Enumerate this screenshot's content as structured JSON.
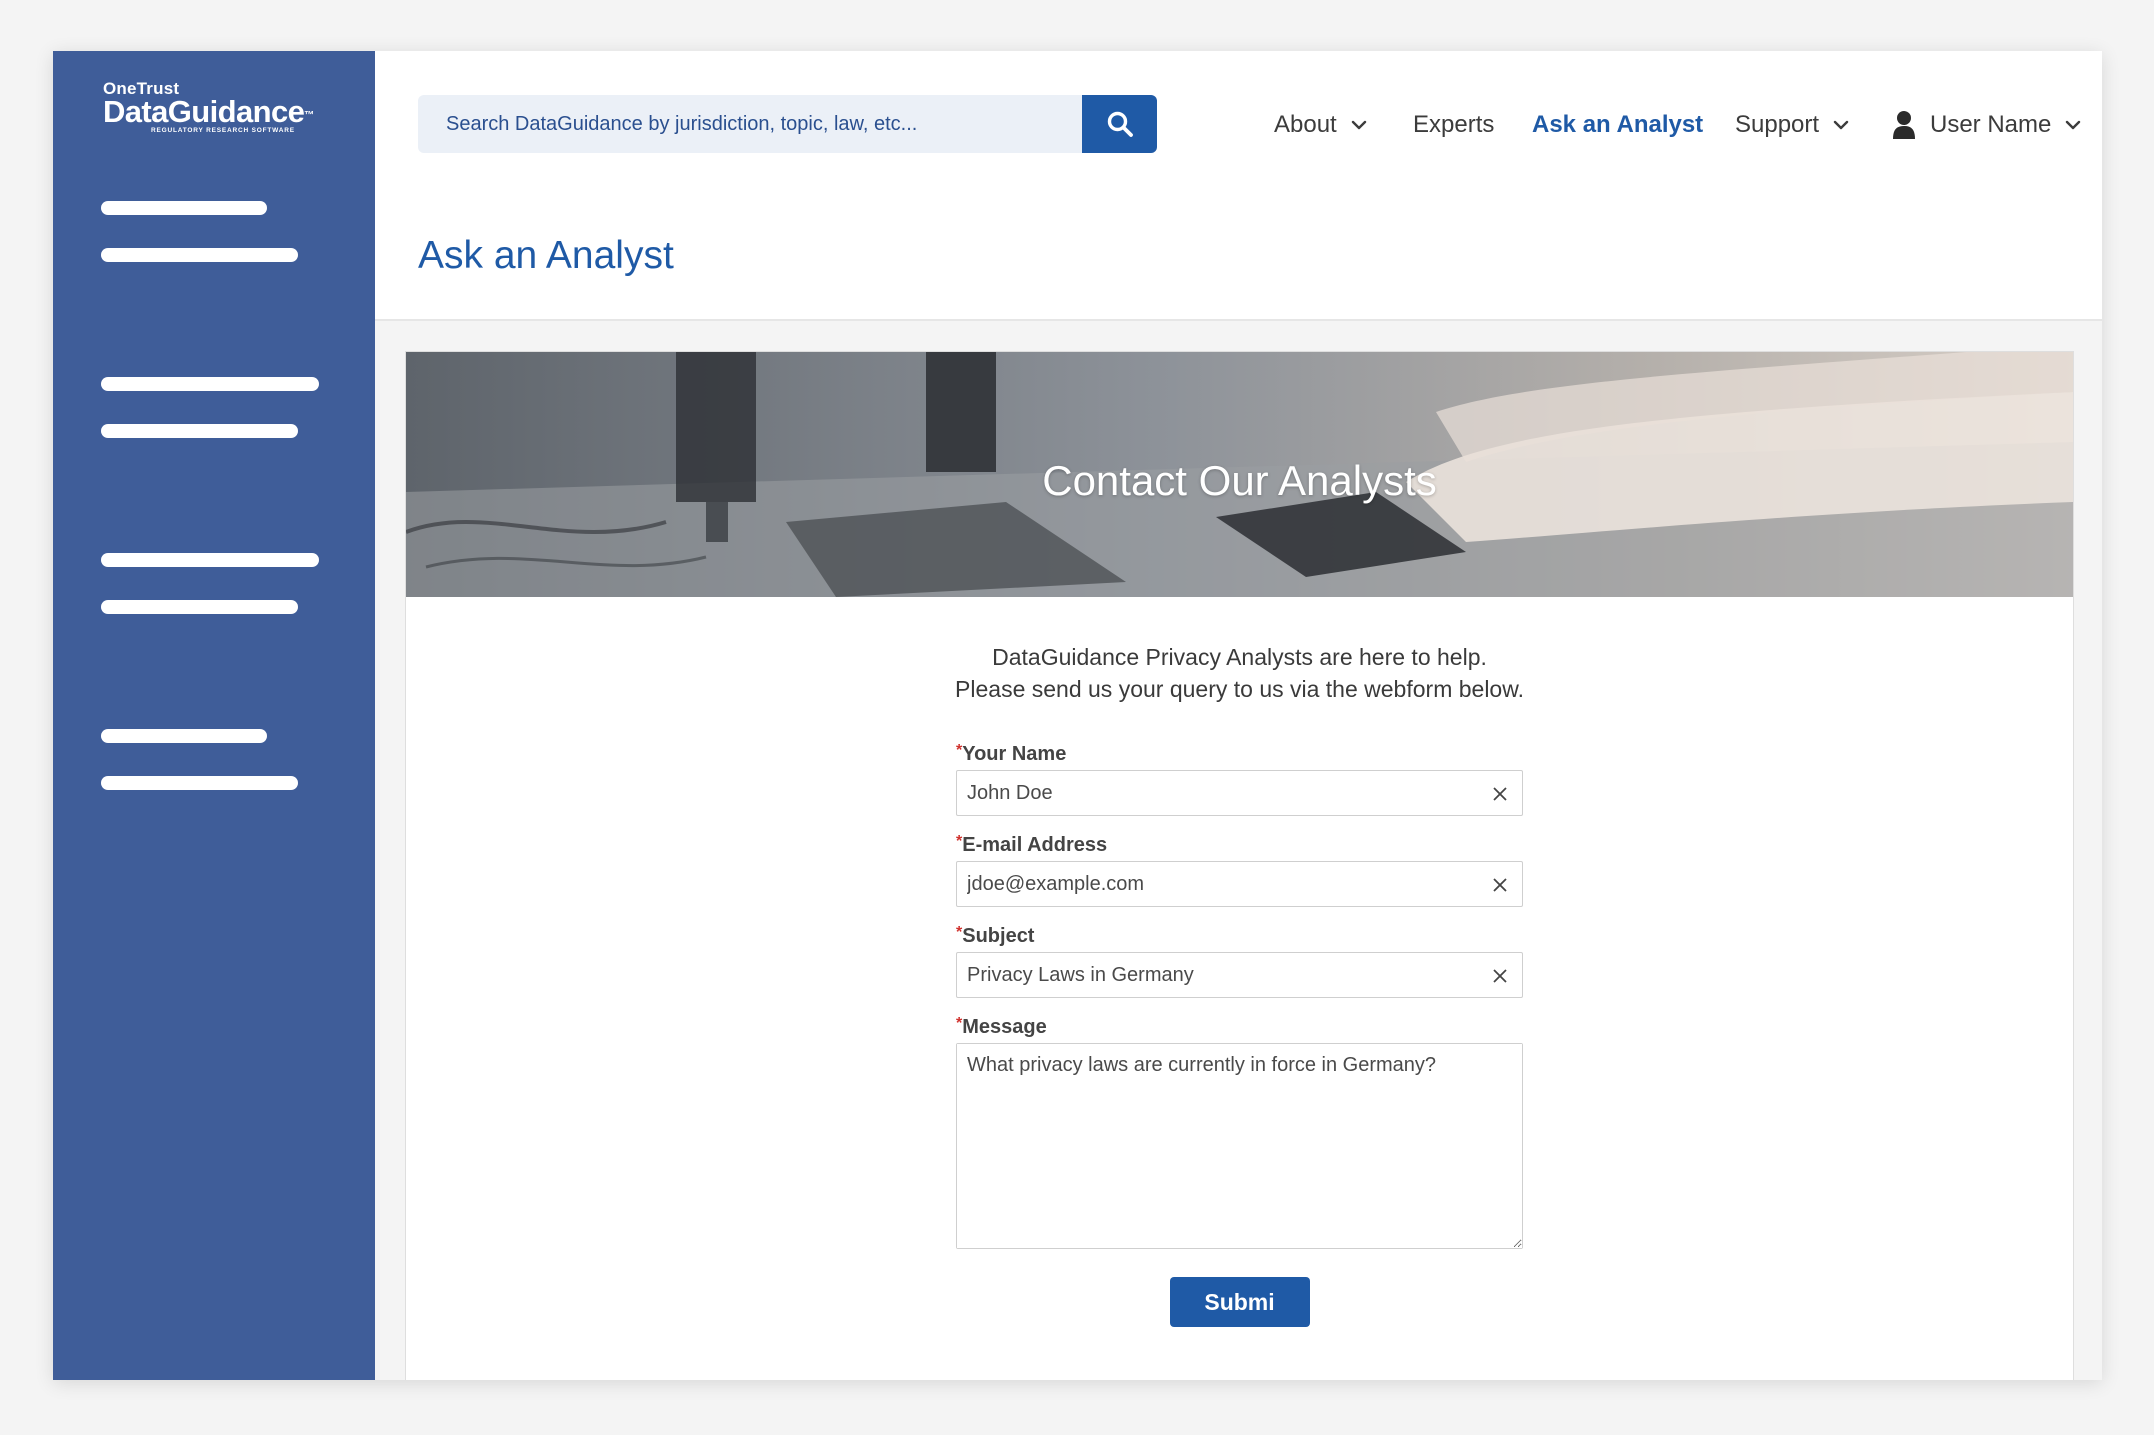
{
  "brand": {
    "company": "OneTrust",
    "product": "DataGuidance",
    "trademark": "™",
    "tagline": "REGULATORY RESEARCH SOFTWARE"
  },
  "search": {
    "placeholder": "Search DataGuidance by jurisdiction, topic, law, etc...",
    "button_icon": "search-icon"
  },
  "nav": {
    "items": [
      {
        "label": "About",
        "has_dropdown": true
      },
      {
        "label": "Experts",
        "has_dropdown": false
      },
      {
        "label": "Ask an Analyst",
        "has_dropdown": false,
        "active": true
      },
      {
        "label": "Support",
        "has_dropdown": true
      }
    ],
    "user": {
      "label": "User Name",
      "icon": "user-icon",
      "has_dropdown": true
    }
  },
  "page": {
    "title": "Ask an Analyst"
  },
  "hero": {
    "title": "Contact Our Analysts"
  },
  "intro": {
    "line1": "DataGuidance Privacy Analysts are here to help.",
    "line2": "Please send us your query to us via the webform below."
  },
  "form": {
    "required_marker": "*",
    "name": {
      "label": "Your Name",
      "value": "John Doe"
    },
    "email": {
      "label": "E-mail Address",
      "value": "jdoe@example.com"
    },
    "subject": {
      "label": "Subject",
      "value": "Privacy Laws in Germany"
    },
    "message": {
      "label": "Message",
      "value": "What privacy laws are currently in force in Germany?"
    },
    "submit_label": "Submi"
  },
  "colors": {
    "sidebar": "#3f5d99",
    "accent": "#1f5aa6",
    "search_bg": "#ebf0f7",
    "required": "#d0312d"
  }
}
